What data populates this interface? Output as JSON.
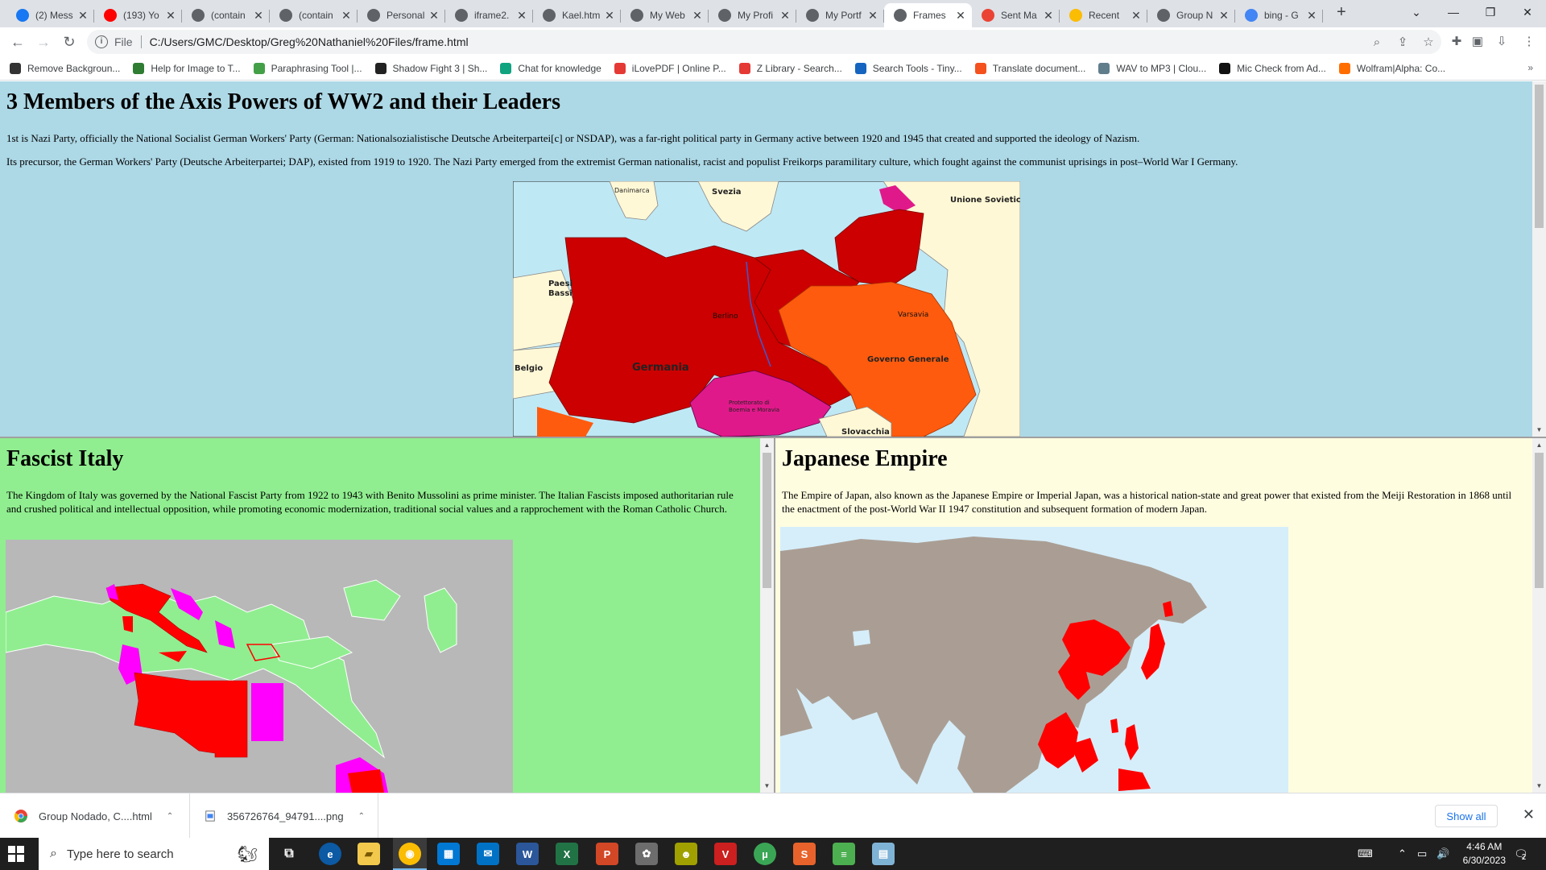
{
  "tabs": [
    {
      "title": "(2) Mess",
      "icon": "facebook-icon",
      "color": "#1877f2"
    },
    {
      "title": "(193) Yo",
      "icon": "youtube-icon",
      "color": "#ff0000"
    },
    {
      "title": "(contain",
      "icon": "globe-icon",
      "color": "#5f6368"
    },
    {
      "title": "(contain",
      "icon": "globe-icon",
      "color": "#5f6368"
    },
    {
      "title": "Personal",
      "icon": "globe-icon",
      "color": "#5f6368"
    },
    {
      "title": "iframe2.",
      "icon": "globe-icon",
      "color": "#5f6368"
    },
    {
      "title": "Kael.htm",
      "icon": "globe-icon",
      "color": "#5f6368"
    },
    {
      "title": "My Web",
      "icon": "globe-icon",
      "color": "#5f6368"
    },
    {
      "title": "My Profi",
      "icon": "globe-icon",
      "color": "#5f6368"
    },
    {
      "title": "My Portf",
      "icon": "globe-icon",
      "color": "#5f6368"
    },
    {
      "title": "Frames",
      "icon": "globe-icon",
      "color": "#5f6368",
      "active": true
    },
    {
      "title": "Sent Ma",
      "icon": "gmail-icon",
      "color": "#ea4335"
    },
    {
      "title": "Recent",
      "icon": "google-drive-icon",
      "color": "#fbbc04"
    },
    {
      "title": "Group N",
      "icon": "globe-icon",
      "color": "#5f6368"
    },
    {
      "title": "bing - G",
      "icon": "google-icon",
      "color": "#4285f4"
    }
  ],
  "address": {
    "scheme": "File",
    "url": "C:/Users/GMC/Desktop/Greg%20Nathaniel%20Files/frame.html"
  },
  "bookmarks": [
    {
      "label": "Remove Backgroun...",
      "color": "#333333"
    },
    {
      "label": "Help for Image to T...",
      "color": "#2e7d32"
    },
    {
      "label": "Paraphrasing Tool |...",
      "color": "#43a047"
    },
    {
      "label": "Shadow Fight 3 | Sh...",
      "color": "#222222"
    },
    {
      "label": "Chat for knowledge",
      "color": "#10a37f"
    },
    {
      "label": "iLovePDF | Online P...",
      "color": "#e53935"
    },
    {
      "label": "Z Library - Search...",
      "color": "#e53935"
    },
    {
      "label": "Search Tools - Tiny...",
      "color": "#1565c0"
    },
    {
      "label": "Translate document...",
      "color": "#f4511e"
    },
    {
      "label": "WAV to MP3 | Clou...",
      "color": "#607d8b"
    },
    {
      "label": "Mic Check from Ad...",
      "color": "#111111"
    },
    {
      "label": "Wolfram|Alpha: Co...",
      "color": "#ff6d00"
    }
  ],
  "top_frame": {
    "title": "3 Members of the Axis Powers of WW2 and their Leaders",
    "paragraphs": [
      "1st is Nazi Party, officially the National Socialist German Workers' Party (German: Nationalsozialistische Deutsche Arbeiterpartei[c] or NSDAP), was a far-right political party in Germany active between 1920 and 1945 that created and supported the ideology of Nazism.",
      "Its precursor, the German Workers' Party (Deutsche Arbeiterpartei; DAP), existed from 1919 to 1920. The Nazi Party emerged from the extremist German nationalist, racist and populist Freikorps paramilitary culture, which fought against the communist uprisings in post–World War I Germany."
    ],
    "map_labels": {
      "danimarca": "Danimarca",
      "svezia": "Svezia",
      "unione_sovietica": "Unione Sovietica",
      "paesi_bassi_1": "Paesi",
      "paesi_bassi_2": "Bassi",
      "berlino": "Berlino",
      "varsavia": "Varsavia",
      "germania": "Germania",
      "belgio": "Belgio",
      "governo_generale": "Governo Generale",
      "protettorato_1": "Protettorato di",
      "protettorato_2": "Boemia e Moravia",
      "slovacchia": "Slovacchia"
    }
  },
  "left_frame": {
    "title": "Fascist Italy",
    "paragraph": "The Kingdom of Italy was governed by the National Fascist Party from 1922 to 1943 with Benito Mussolini as prime minister. The Italian Fascists imposed authoritarian rule and crushed political and intellectual opposition, while promoting economic modernization, traditional social values and a rapprochement with the Roman Catholic Church."
  },
  "right_frame": {
    "title": "Japanese Empire",
    "paragraph": "The Empire of Japan, also known as the Japanese Empire or Imperial Japan, was a historical nation-state and great power that existed from the Meiji Restoration in 1868 until the enactment of the post-World War II 1947 constitution and subsequent formation of modern Japan."
  },
  "downloads": [
    {
      "name": "Group Nodado, C....html",
      "icon": "chrome-icon"
    },
    {
      "name": "356726764_94791....png",
      "icon": "image-file-icon"
    }
  ],
  "downloads_show_all": "Show all",
  "taskbar": {
    "search_placeholder": "Type here to search",
    "time": "4:46 AM",
    "date": "6/30/2023",
    "notifications": "2"
  }
}
